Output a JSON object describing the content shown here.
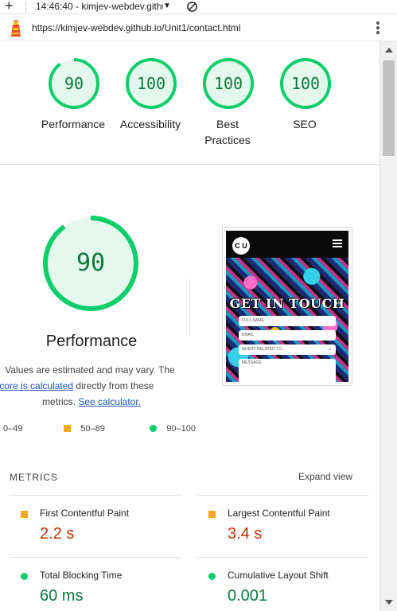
{
  "tab": {
    "title": "14:46:40 - kimjev-webdev.githu"
  },
  "address": {
    "url": "https://kimjev-webdev.github.io/Unit1/contact.html"
  },
  "scores": [
    {
      "label": "Performance",
      "value": "90",
      "fraction": 0.9
    },
    {
      "label": "Accessibility",
      "value": "100",
      "fraction": 1.0
    },
    {
      "label_line1": "Best",
      "label_line2": "Practices",
      "value": "100",
      "fraction": 1.0
    },
    {
      "label": "SEO",
      "value": "100",
      "fraction": 1.0
    }
  ],
  "performance": {
    "score": "90",
    "fraction": 0.9,
    "title": "Performance",
    "note_line1": "Values are estimated and may vary. The",
    "note_link": "formance score is calculated",
    "note_line2_rest": " directly from these",
    "note_line3_pre": "metrics. ",
    "note_calc_link": "See calculator."
  },
  "thumbnail": {
    "logo": "C U",
    "heading": "GET IN TOUCH",
    "fields": [
      "FULL NAME",
      "EMAIL",
      "QUERY RELATED TO...",
      "MESSAGE"
    ]
  },
  "legend": {
    "fail": "0–49",
    "average": "50–89",
    "pass": "90–100"
  },
  "metrics": {
    "header": "METRICS",
    "expand": "Expand view",
    "items": [
      {
        "label": "First Contentful Paint",
        "value": "2.2 s",
        "status": "average"
      },
      {
        "label": "Largest Contentful Paint",
        "value": "3.4 s",
        "status": "average"
      },
      {
        "label": "Total Blocking Time",
        "value": "60 ms",
        "status": "pass"
      },
      {
        "label": "Cumulative Layout Shift",
        "value": "0.001",
        "status": "pass"
      }
    ]
  },
  "colors": {
    "pass": "#0cce6b",
    "average": "#f4a825",
    "pass_text": "#0c7a3c",
    "average_text": "#c33300",
    "gauge_bg": "#e5f8ee"
  }
}
